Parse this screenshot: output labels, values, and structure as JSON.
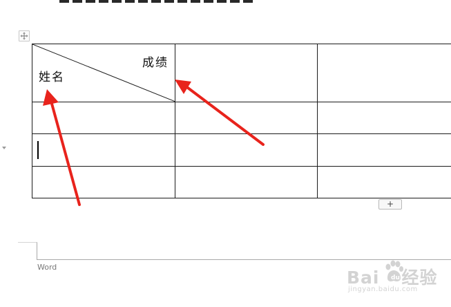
{
  "table": {
    "header_cell": {
      "top_right_label": "成绩",
      "bottom_left_label": "姓名"
    }
  },
  "controls": {
    "add_row_label": "+"
  },
  "footer": {
    "app_label": "Word"
  },
  "watermark": {
    "brand_left": "Bai",
    "brand_right": "经验",
    "url": "jingyan.baidu.com"
  },
  "colors": {
    "annotation_arrow": "#e8231c",
    "table_border": "#1a1a1a"
  },
  "icons": {
    "move_handle": "four-way-arrow-icon",
    "watermark_logo": "baidu-paw-icon"
  }
}
